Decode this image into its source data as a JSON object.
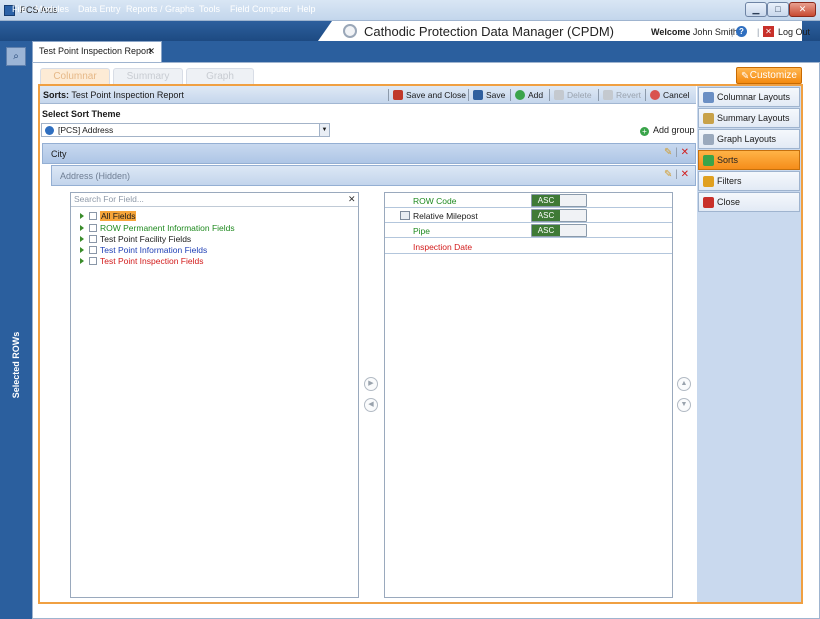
{
  "window": {
    "title": "PCS Axis",
    "controls": [
      "minimize",
      "maximize",
      "close"
    ]
  },
  "menu": {
    "items": [
      "File",
      "Modules",
      "Data Entry",
      "Reports / Graphs",
      "Tools",
      "Field Computer",
      "Help"
    ],
    "app_title": "Cathodic Protection Data Manager (CPDM)",
    "welcome_label": "Welcome",
    "user": "John Smith",
    "logout": "Log Out"
  },
  "left_strip": {
    "label": "Selected ROWs"
  },
  "doc_tab": {
    "label": "Test Point Inspection Report",
    "close": "✕"
  },
  "view_tabs": [
    "Columnar",
    "Summary",
    "Graph"
  ],
  "customize_label": "Customize",
  "toolbar": {
    "sorts_label": "Sorts:",
    "sorts_name": "Test Point Inspection Report",
    "save_close": "Save and Close",
    "save": "Save",
    "add": "Add",
    "delete": "Delete",
    "revert": "Revert",
    "cancel": "Cancel"
  },
  "theme": {
    "label": "Select Sort Theme",
    "value": "[PCS] Address",
    "add_group": "Add group"
  },
  "groups": [
    {
      "label": "City"
    },
    {
      "label": "Address (Hidden)"
    }
  ],
  "field_search": {
    "placeholder": "Search For Field...",
    "clear": "✕"
  },
  "field_tree": [
    {
      "label": "All Fields",
      "color": "#1a1a1a"
    },
    {
      "label": "ROW Permanent Information Fields",
      "color": "#1f8a1f"
    },
    {
      "label": "Test Point Facility Fields",
      "color": "#1a1a1a"
    },
    {
      "label": "Test Point Information Fields",
      "color": "#1f3fb5"
    },
    {
      "label": "Test Point Inspection Fields",
      "color": "#d21b1b"
    }
  ],
  "sort_fields": [
    {
      "label": "ROW Code",
      "color": "#1f8a1f",
      "order": "ASC"
    },
    {
      "label": "Relative Milepost",
      "color": "#1a1a1a",
      "order": "ASC"
    },
    {
      "label": "Pipe",
      "color": "#1f8a1f",
      "order": "ASC"
    },
    {
      "label": "Inspection Date",
      "color": "#d21b1b",
      "order": ""
    }
  ],
  "sidebar": {
    "items": [
      "Columnar Layouts",
      "Summary Layouts",
      "Graph Layouts",
      "Sorts",
      "Filters",
      "Close"
    ],
    "active": "Sorts"
  },
  "colors": {
    "accent": "#f58d1a",
    "nav": "#2b5f9e",
    "asc": "#3f7a36"
  }
}
